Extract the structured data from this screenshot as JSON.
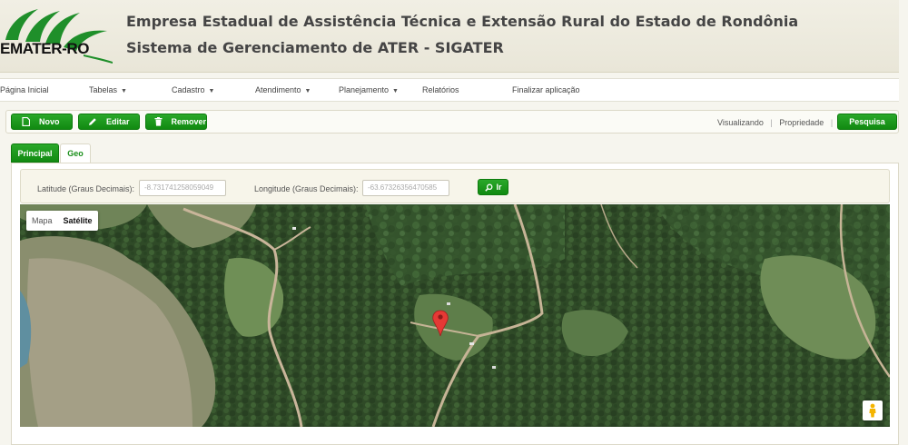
{
  "header": {
    "logo_text": "EMATER-RO",
    "title_line1": "Empresa Estadual de Assistência Técnica e Extensão Rural do Estado de Rondônia",
    "title_line2": "Sistema de Gerenciamento de ATER - SIGATER"
  },
  "nav": {
    "items": [
      {
        "label": "Página Inicial",
        "dropdown": false
      },
      {
        "label": "Tabelas",
        "dropdown": true
      },
      {
        "label": "Cadastro",
        "dropdown": true
      },
      {
        "label": "Atendimento",
        "dropdown": true
      },
      {
        "label": "Planejamento",
        "dropdown": true
      },
      {
        "label": "Relatórios",
        "dropdown": false
      },
      {
        "label": "Finalizar aplicação",
        "dropdown": false
      }
    ]
  },
  "toolbar": {
    "new_label": "Novo",
    "edit_label": "Editar",
    "remove_label": "Remover",
    "view_label": "Visualizando",
    "property_label": "Propriedade",
    "search_label": "Pesquisa"
  },
  "tabs": [
    {
      "label": "Principal",
      "active": false
    },
    {
      "label": "Geo",
      "active": true
    }
  ],
  "geo": {
    "latitude_label": "Latitude (Graus Decimais):",
    "latitude_value": "-8.731741258059049",
    "longitude_label": "Longitude (Graus Decimais):",
    "longitude_value": "-63.67326356470585",
    "go_label": "Ir"
  },
  "map": {
    "type_map": "Mapa",
    "type_satellite": "Satélite",
    "selected_type": "Satélite",
    "marker_color": "#e53935"
  },
  "colors": {
    "accent_green": "#1a8f1a",
    "header_bg": "#eeebdf",
    "title_text": "#454545"
  },
  "icons": {
    "new": "document-icon",
    "edit": "pencil-icon",
    "remove": "trash-icon",
    "go": "search-icon",
    "pegman": "pegman-icon"
  }
}
